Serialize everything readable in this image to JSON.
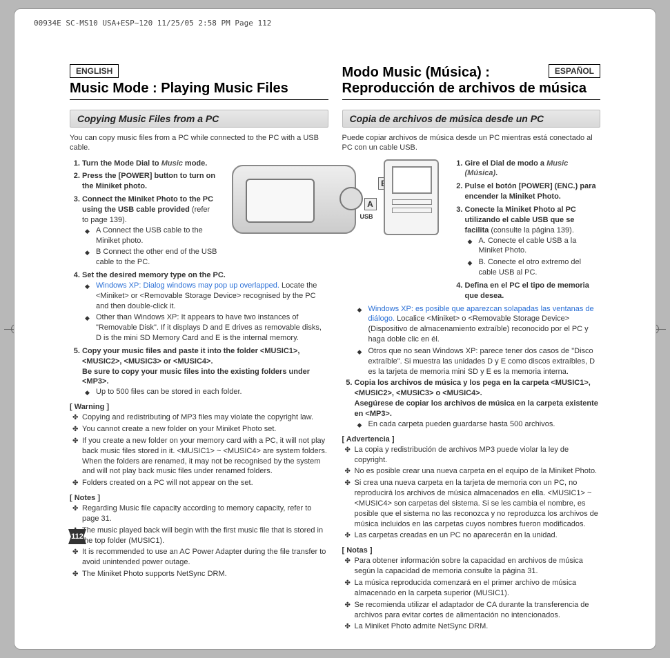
{
  "header_strip": "00934E SC-MS10 USA+ESP~120  11/25/05 2:58 PM  Page 112",
  "page_number": "112",
  "illus": {
    "label_a": "A",
    "label_b": "B",
    "usb": "USB"
  },
  "en": {
    "lang": "ENGLISH",
    "title": "Music Mode : Playing Music Files",
    "section": "Copying Music Files from a PC",
    "intro": "You can copy music files from a PC while connected to the PC with a USB cable.",
    "step1_pre": "Turn the Mode Dial to ",
    "step1_mode": "Music",
    "step1_post": " mode.",
    "step2": "Press the [POWER] button to turn on the Miniket photo.",
    "step3_bold": "Connect the Miniket Photo to the PC using the USB cable provided",
    "step3_ref": " (refer to page 139).",
    "step3a": "A Connect the USB cable to the Miniket photo.",
    "step3b": "B Connect the other end of the USB cable to the PC.",
    "step4": "Set the desired memory type on the PC.",
    "step4a_blue": "Windows XP: Dialog windows may pop up overlapped.",
    "step4a_rest": " Locate the <Miniket> or <Removable Storage Device> recognised by the PC and then double-click it.",
    "step4b": "Other than Windows XP: It appears to have two instances of \"Removable Disk\". If it displays D and E drives as removable disks, D is the mini SD Memory Card and E is the internal memory.",
    "step5_l1": "Copy your music files and paste it into the folder <MUSIC1>, <MUSIC2>, <MUSIC3> or <MUSIC4>.",
    "step5_l2": "Be sure to copy your music files into the existing folders under <MP3>.",
    "step5a": "Up to 500 files can be stored in each folder.",
    "warn_hd": "[ Warning ]",
    "warn1": "Copying and redistributing of MP3 files may violate the copyright law.",
    "warn2": "You cannot create a new folder on your Miniket Photo set.",
    "warn3": "If you create a new folder on your memory card with a PC, it will not play back music files stored in it. <MUSIC1> ~ <MUSIC4> are system folders. When the folders are renamed, it may not be recognised by the system and will not play back music files under renamed folders.",
    "warn4": "Folders created on a PC will not appear on the set.",
    "notes_hd": "[ Notes ]",
    "note1": "Regarding Music file capacity according to memory capacity, refer to page 31.",
    "note2": "The music played back will begin with the first music file that is stored in the top folder (MUSIC1).",
    "note3": "It is recommended to use an AC Power Adapter during the file transfer to avoid unintended power outage.",
    "note4": "The Miniket Photo supports NetSync DRM."
  },
  "es": {
    "lang": "ESPAÑOL",
    "title_l1": "Modo Music (Música) :",
    "title_l2": "Reproducción de archivos de música",
    "section": "Copia de archivos de música desde un PC",
    "intro": "Puede copiar archivos de música desde un PC mientras está conectado al PC con un cable USB.",
    "step1_pre": "Gire el Dial de modo a ",
    "step1_mode": "Music (Música)",
    "step1_post": ".",
    "step2": "Pulse el botón [POWER] (ENC.) para encender la Miniket Photo.",
    "step3_bold": "Conecte la Miniket Photo al PC utilizando el cable USB que se facilita",
    "step3_ref": " (consulte la página 139).",
    "step3a": "A. Conecte el cable USB a la Miniket Photo.",
    "step3b": "B. Conecte el otro extremo del cable USB al PC.",
    "step4": "Defina en el PC el tipo de memoria que desea.",
    "step4a_blue": "Windows XP: es posible que aparezcan solapadas las ventanas de diálogo.",
    "step4a_rest": " Localice <Miniket> o <Removable Storage Device> (Dispositivo de almacenamiento extraíble) reconocido por el PC y haga doble clic en él.",
    "step4b": "Otros que no sean Windows XP: parece tener dos casos de \"Disco extraíble\". Si muestra las unidades D y E como discos extraíbles, D es la tarjeta de memoria mini SD y E es la memoria interna.",
    "step5_l1": "Copia los archivos de música y los pega en la carpeta <MUSIC1>, <MUSIC2>, <MUSIC3> o <MUSIC4>.",
    "step5_l2": "Asegúrese de copiar los archivos de música en la carpeta existente en <MP3>.",
    "step5a": "En cada carpeta pueden guardarse hasta 500 archivos.",
    "warn_hd": "[ Advertencia ]",
    "warn1": "La copia y redistribución de archivos MP3 puede violar la ley de copyright.",
    "warn2": "No es posible crear una nueva carpeta en el equipo de la Miniket Photo.",
    "warn3": "Si crea una nueva carpeta en la tarjeta de memoria con un PC, no reproducirá los archivos de música almacenados en ella. <MUSIC1> ~ <MUSIC4> son carpetas del sistema. Si se les cambia el nombre, es posible que el sistema no las reconozca y no reproduzca los archivos de música incluidos en las carpetas cuyos nombres fueron modificados.",
    "warn4": "Las carpetas creadas en un PC no aparecerán en la unidad.",
    "notes_hd": "[ Notas ]",
    "note1": "Para obtener información sobre la capacidad en archivos de música según la capacidad de memoria consulte la página 31.",
    "note2": "La música reproducida comenzará en el primer archivo de música almacenado en la carpeta superior (MUSIC1).",
    "note3": "Se recomienda utilizar el adaptador de CA durante la transferencia de archivos para evitar cortes de alimentación no intencionados.",
    "note4": "La Miniket Photo admite NetSync DRM."
  }
}
